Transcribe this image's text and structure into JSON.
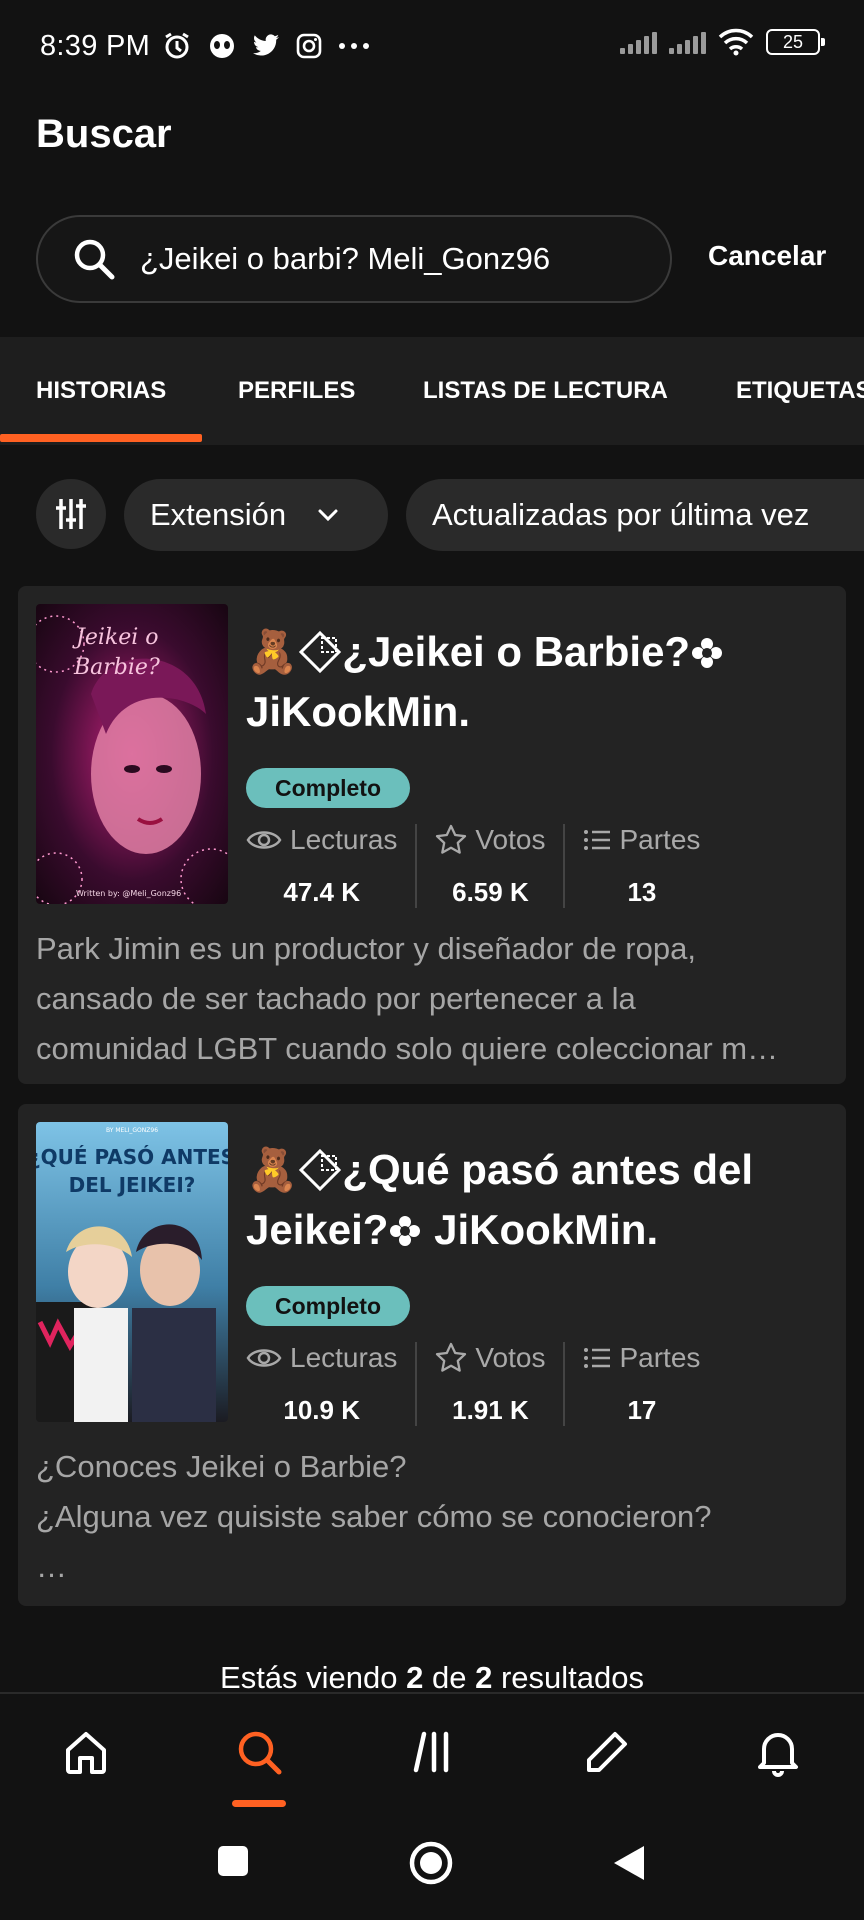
{
  "status_bar": {
    "time": "8:39 PM",
    "battery": "25"
  },
  "header": {
    "title": "Buscar"
  },
  "search": {
    "value": "¿Jeikei o barbi? Meli_Gonz96",
    "cancel_label": "Cancelar"
  },
  "tabs": [
    {
      "label": "HISTORIAS"
    },
    {
      "label": "PERFILES"
    },
    {
      "label": "LISTAS DE LECTURA"
    },
    {
      "label": "ETIQUETAS"
    }
  ],
  "filters": {
    "length_label": "Extensión",
    "updated_label": "Actualizadas por última vez"
  },
  "stories": [
    {
      "title_line1": "¿Jeikei o Barbie?",
      "title_line2": "JiKookMin.",
      "status": "Completo",
      "reads_label": "Lecturas",
      "reads": "47.4 K",
      "votes_label": "Votos",
      "votes": "6.59 K",
      "parts_label": "Partes",
      "parts": "13",
      "desc_lines": [
        "Park Jimin es un productor y diseñador de ropa,",
        "cansado de ser tachado por pertenecer a la",
        "comunidad LGBT cuando solo quiere coleccionar m…"
      ],
      "cover": {
        "line1": "Jeikei o",
        "line2": "Barbie?",
        "credit": "Written by: @Meli_Gonz96",
        "colors": [
          "#3a0b2e",
          "#c0217a",
          "#180612"
        ]
      }
    },
    {
      "title_line1": "¿Qué pasó antes del",
      "title_line2": "Jeikei?",
      "title_line2_suffix": "JiKookMin.",
      "status": "Completo",
      "reads_label": "Lecturas",
      "reads": "10.9 K",
      "votes_label": "Votos",
      "votes": "1.91 K",
      "parts_label": "Partes",
      "parts": "17",
      "desc_lines": [
        "¿Conoces Jeikei o Barbie?",
        "¿Alguna vez quisiste saber cómo se conocieron?",
        "…"
      ],
      "cover": {
        "author": "BY MELI_GONZ96",
        "line1": "¿QUÉ PASÓ ANTES",
        "line2": "DEL JEIKEI?",
        "colors": [
          "#7ec3e6",
          "#3f7fa6",
          "#1b1b22"
        ]
      }
    }
  ],
  "results": {
    "prefix": "Estás viendo ",
    "shown": "2",
    "middle": " de ",
    "total": "2",
    "suffix": " resultados"
  },
  "colors": {
    "accent": "#ff6122",
    "badge": "#6bbfbc",
    "card": "#232323",
    "background": "#121212"
  },
  "icons": [
    "alarm-icon",
    "alien-icon",
    "twitter-icon",
    "instagram-icon",
    "more-icon",
    "signal-icon",
    "wifi-icon",
    "battery-icon",
    "search-icon",
    "sliders-icon",
    "chevron-down-icon",
    "bear-emoji-icon",
    "diamond-icon",
    "flower-icon",
    "eye-icon",
    "star-icon",
    "list-icon",
    "home-icon",
    "library-icon",
    "pencil-icon",
    "bell-icon",
    "square-icon",
    "circle-icon",
    "back-icon"
  ]
}
